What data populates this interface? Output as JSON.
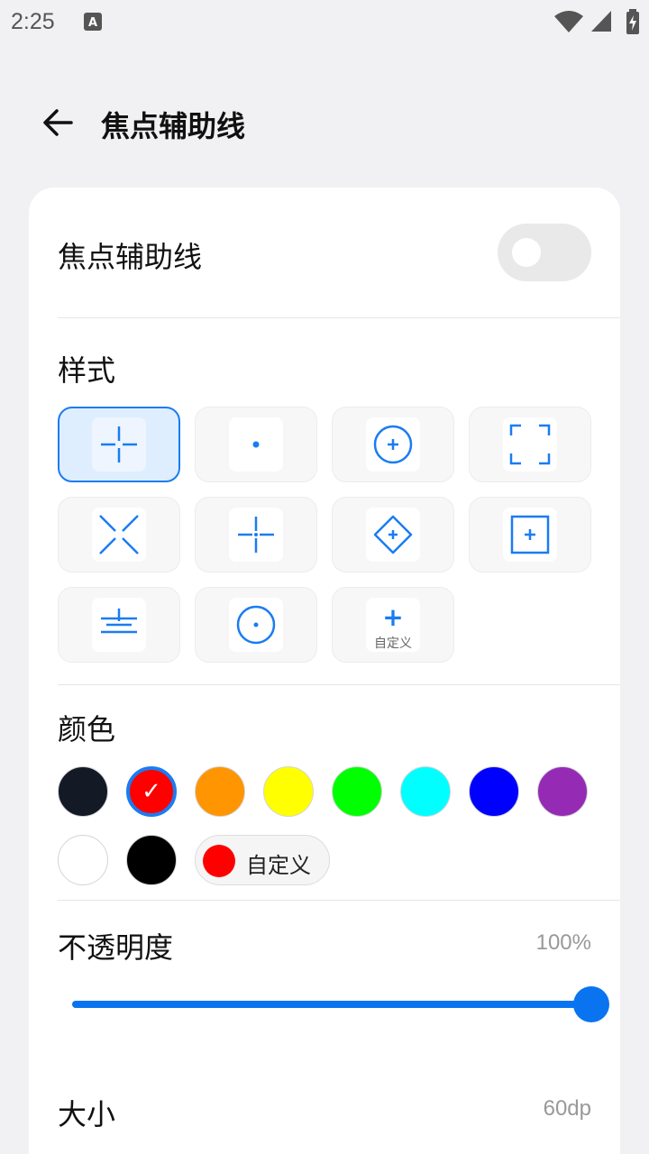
{
  "status_bar": {
    "time": "2:25",
    "app_icon": "A",
    "icons": [
      "wifi-icon",
      "cell-signal-icon",
      "battery-charging-icon"
    ]
  },
  "app_bar": {
    "back_icon": "arrow-left-icon",
    "title": "焦点辅助线"
  },
  "toggle": {
    "label": "焦点辅助线",
    "enabled": false
  },
  "style_section": {
    "label": "样式",
    "selected_index": 0,
    "options": [
      "crosshair-gap-icon",
      "center-dot-icon",
      "circle-plus-icon",
      "corner-brackets-icon",
      "diagonal-x-icon",
      "crosshair-dot-icon",
      "diamond-plus-icon",
      "square-plus-icon",
      "horizontal-lines-plus-icon",
      "circle-dot-icon",
      "custom-style-icon"
    ],
    "custom_label": "自定义",
    "custom_plus": "+"
  },
  "color_section": {
    "label": "颜色",
    "selected_index": 1,
    "check_mark": "✓",
    "swatches": [
      "#131925",
      "#ff0000",
      "#ff9500",
      "#ffff00",
      "#00ff00",
      "#00ffff",
      "#0000ff",
      "#952bb5",
      "#ffffff",
      "#000000"
    ],
    "custom_label": "自定义",
    "custom_color": "#ff0000"
  },
  "opacity": {
    "label": "不透明度",
    "value_text": "100%",
    "value": 1.0
  },
  "size": {
    "label": "大小",
    "value_text": "60dp"
  },
  "colors": {
    "accent": "#1a7cf2",
    "slider": "#0a74f0"
  }
}
